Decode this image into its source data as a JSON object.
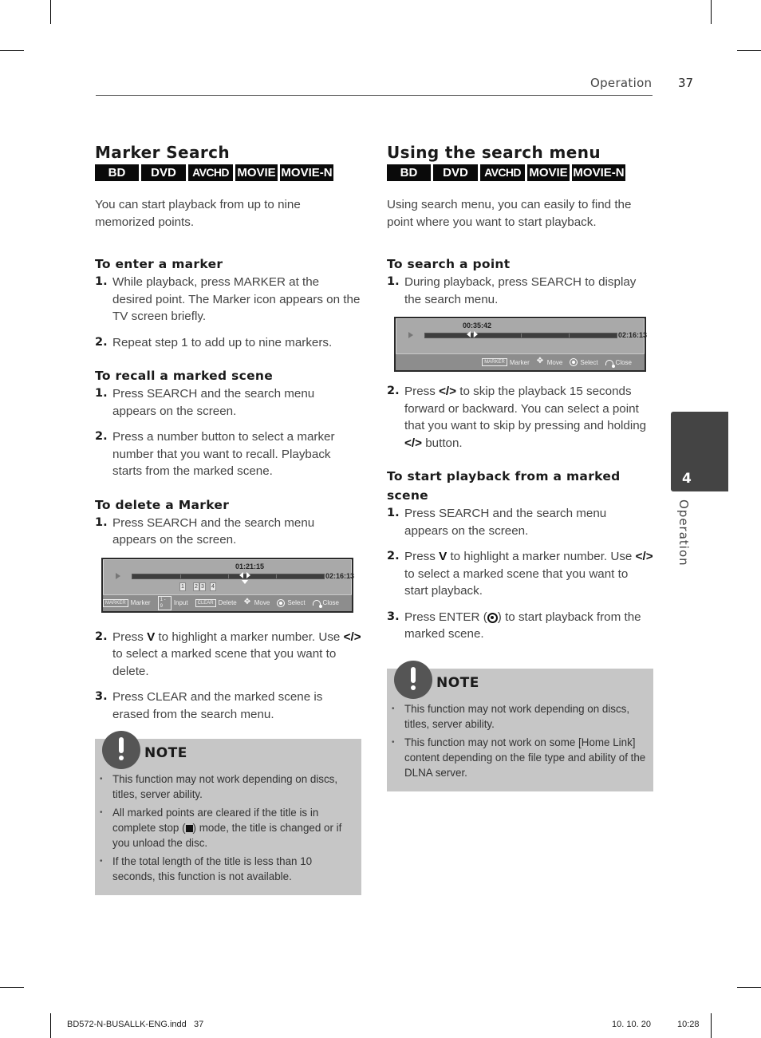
{
  "header": {
    "section": "Operation",
    "page_number": "37"
  },
  "left": {
    "title": "Marker Search",
    "badges": [
      "BD",
      "DVD",
      "AVCHD",
      "MOVIE",
      "MOVIE-N"
    ],
    "intro": "You can start playback from up to nine memorized points.",
    "enter": {
      "heading": "To enter a marker",
      "steps": [
        {
          "num": "1.",
          "text": "While playback, press MARKER at the desired point. The Marker icon appears on the TV screen briefly."
        },
        {
          "num": "2.",
          "text": "Repeat step 1 to add up to nine markers."
        }
      ]
    },
    "recall": {
      "heading": "To recall a marked scene",
      "steps": [
        {
          "num": "1.",
          "text": "Press SEARCH and the search menu appears on the screen."
        },
        {
          "num": "2.",
          "text": "Press a number button to select a marker number that you want to recall. Playback starts from the marked scene."
        }
      ]
    },
    "delete": {
      "heading": "To delete a Marker",
      "step1": {
        "num": "1.",
        "text": "Press SEARCH and the search menu appears on the screen."
      },
      "osd": {
        "current_time": "01:21:15",
        "total_time": "02:16:13",
        "progress": 0.59,
        "markers": [
          "1",
          "2",
          "3",
          "4"
        ],
        "controls": [
          {
            "key": "MARKER",
            "label": "Marker"
          },
          {
            "key": "1 - 9",
            "label": "Input"
          },
          {
            "key": "CLEAR",
            "label": "Delete"
          },
          {
            "icon": "move-arrows-icon",
            "label": "Move"
          },
          {
            "icon": "select-circle-icon",
            "label": "Select"
          },
          {
            "icon": "back-return-icon",
            "label": "Close"
          }
        ]
      },
      "step2": {
        "num": "2.",
        "a": "Press",
        "sym1": "V",
        "b": "to highlight a marker number. Use",
        "sym2": "</>",
        "c": "to select a marked scene that you want to delete."
      },
      "step3": {
        "num": "3.",
        "text": "Press CLEAR and the marked scene is erased from the search menu."
      }
    },
    "note": {
      "title": "NOTE",
      "items": [
        "This function may not work depending on discs, titles, server ability.",
        "All marked points are cleared if the title is in complete stop (",
        "If the total length of the title is less than 10 seconds, this function is not available."
      ],
      "item2_tail": ") mode, the title is changed or if you unload the disc."
    }
  },
  "right": {
    "title": "Using the search menu",
    "badges": [
      "BD",
      "DVD",
      "AVCHD",
      "MOVIE",
      "MOVIE-N"
    ],
    "intro": "Using search menu, you can easily to find the point where you want to start playback.",
    "search": {
      "heading": "To search a point",
      "step1": {
        "num": "1.",
        "text": "During playback, press SEARCH to display the search menu."
      },
      "osd": {
        "current_time": "00:35:42",
        "total_time": "02:16:13",
        "progress": 0.25,
        "controls": [
          {
            "key": "MARKER",
            "label": "Marker"
          },
          {
            "icon": "move-arrows-icon",
            "label": "Move"
          },
          {
            "icon": "select-circle-icon",
            "label": "Select"
          },
          {
            "icon": "back-return-icon",
            "label": "Close"
          }
        ]
      },
      "step2": {
        "num": "2.",
        "a": "Press",
        "sym1": "</>",
        "b": "to skip the playback 15 seconds forward or backward. You can select a point that you want to skip by pressing and holding",
        "sym2": "</>",
        "c": "button."
      }
    },
    "start": {
      "heading": "To start playback from a marked scene",
      "step1": {
        "num": "1.",
        "text": "Press SEARCH and the search menu appears on the screen."
      },
      "step2": {
        "num": "2.",
        "a": "Press",
        "sym1": "V",
        "b": "to highlight a marker number. Use",
        "sym2": "</>",
        "c": "to select a marked scene that you want to start playback."
      },
      "step3": {
        "num": "3.",
        "a": "Press ENTER (",
        "b": ") to start playback from the marked scene."
      }
    },
    "note": {
      "title": "NOTE",
      "items": [
        "This function may not work depending on discs, titles, server ability.",
        "This function may not work on some [Home Link] content depending on the file type and ability of the DLNA server."
      ]
    }
  },
  "side_tab": {
    "number": "4",
    "label": "Operation"
  },
  "footer": {
    "file": "BD572-N-BUSALLK-ENG.indd   37",
    "date": "10. 10. 20",
    "time": "10:28"
  }
}
